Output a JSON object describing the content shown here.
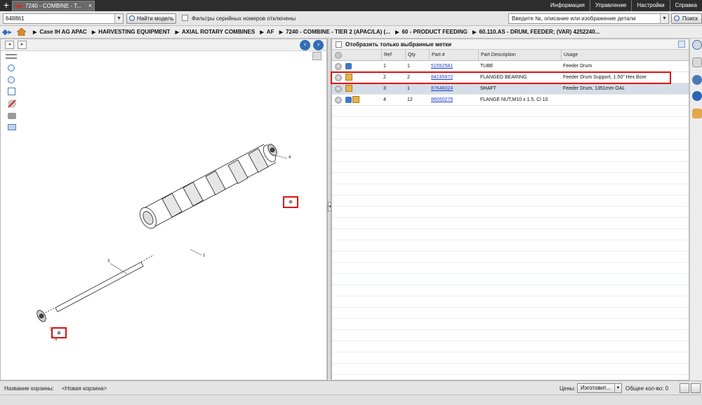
{
  "tab": {
    "title": "7240 - COMBINE - T...",
    "close": "×"
  },
  "top_menu": [
    "Информация",
    "Управление",
    "Настройки",
    "Справка"
  ],
  "model_select": {
    "value": "648861"
  },
  "find_model_button": "Найти модель",
  "serial_filter_label": "Фильтры серийных номеров отключены",
  "search": {
    "placeholder": "Введите №, описание или изображение детали",
    "button": "Поиск"
  },
  "breadcrumbs": [
    "Case IH AG APAC",
    "HARVESTING EQUIPMENT",
    "AXIAL ROTARY COMBINES",
    "AF",
    "7240 - COMBINE - TIER 2 (APAC/LA) (...",
    "60 - PRODUCT FEEDING",
    "60.110.AS - DRUM, FEEDER; (VAR) 4252240..."
  ],
  "drawing": {
    "callouts": [
      "4",
      "3",
      "1",
      "4"
    ]
  },
  "parts_panel": {
    "show_selected_label": "Отобразить только выбранные метки",
    "columns": [
      "Ref",
      "Qty",
      "Part #",
      "Part Description",
      "Usage"
    ],
    "rows": [
      {
        "ref": "1",
        "qty": "1",
        "part": "51552581",
        "desc": "TUBE",
        "usage": "Feeder Drum"
      },
      {
        "ref": "2",
        "qty": "2",
        "part": "84195972",
        "desc": "FLANGED BEARING",
        "usage": "Feeder Drum Support, 1.50\" Hex Bore"
      },
      {
        "ref": "3",
        "qty": "1",
        "part": "87646024",
        "desc": "SHAFT",
        "usage": "Feeder Drum, 1351mm OAL"
      },
      {
        "ref": "4",
        "qty": "12",
        "part": "86050279",
        "desc": "FLANGE NUT,M10 x 1.5, Cl 10",
        "usage": ""
      }
    ]
  },
  "bottom": {
    "cart_label": "Название корзины:",
    "cart_name": "<Новая корзина>",
    "prices_label": "Цены:",
    "prices_value": "Изготовит...",
    "total_qty_label": "Общее кол-во: 0"
  },
  "colors": {
    "accent_blue": "#2f6fb7",
    "highlight_red": "#e01010",
    "link": "#1b3cc9"
  }
}
